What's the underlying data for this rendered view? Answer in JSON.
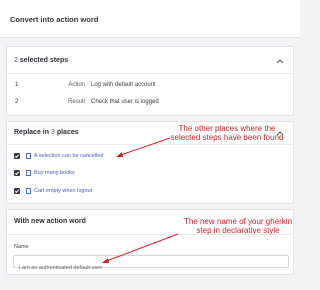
{
  "header": {
    "title": "Convert into action word"
  },
  "steps_panel": {
    "count": "2",
    "title_suffix": "selected steps",
    "steps": [
      {
        "index": "1",
        "kind": "Action",
        "text": "Log with default account"
      },
      {
        "index": "2",
        "kind": "Result",
        "text": "Check that user is logged"
      }
    ]
  },
  "places_panel": {
    "title_prefix": "Replace in",
    "count": "3",
    "title_suffix": "places",
    "places": [
      {
        "label": "A selection can be cancelled",
        "checked": true
      },
      {
        "label": "Buy many books",
        "checked": true
      },
      {
        "label": "Cart empty when logout",
        "checked": true
      }
    ]
  },
  "action_word_panel": {
    "title": "With new action word",
    "name_label": "Name",
    "name_value": "I am an authenticated default user"
  },
  "annotations": {
    "places_note": "The other places where the selected steps have been found",
    "name_note": "The new name of your gherkin step in declarative style"
  },
  "colors": {
    "annotation": "#d0202a",
    "link": "#3f5fc0",
    "checkbox": "#3a3a46"
  }
}
